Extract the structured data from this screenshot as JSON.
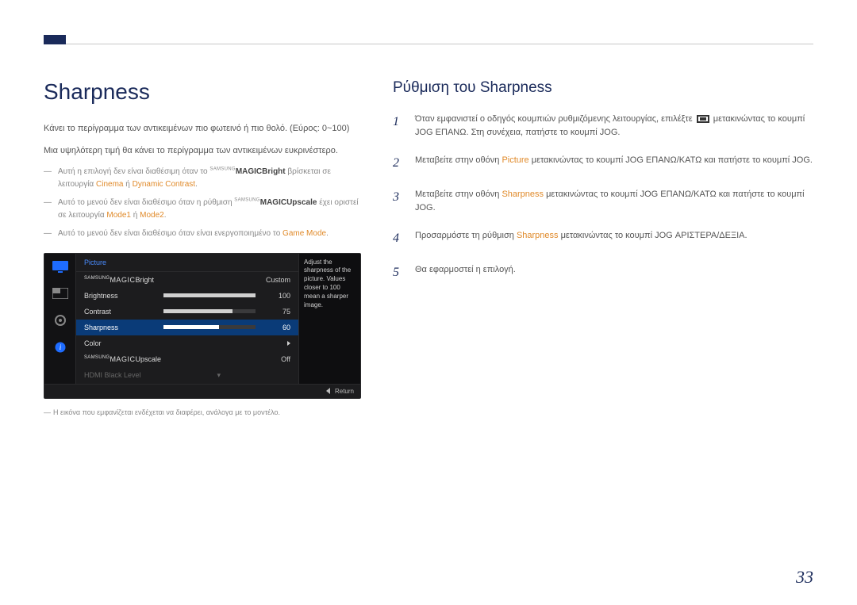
{
  "page_number": "33",
  "left": {
    "title": "Sharpness",
    "p1": "Κάνει το περίγραμμα των αντικειμένων πιο φωτεινό ή πιο θολό. (Εύρος: 0~100)",
    "p2": "Μια υψηλότερη τιμή θα κάνει το περίγραμμα των αντικειμένων ευκρινέστερο.",
    "notes": {
      "n1_pre": "Αυτή η επιλογή δεν είναι διαθέσιμη όταν το ",
      "n1_brand_tiny": "SAMSUNG",
      "n1_brand_bold": "MAGIC",
      "n1_bright": "Bright",
      "n1_mid": " βρίσκεται σε λειτουργία ",
      "n1_cinema": "Cinema",
      "n1_or": " ή ",
      "n1_dc": "Dynamic Contrast",
      "n1_end": ".",
      "n2_pre": "Αυτό το μενού δεν είναι διαθέσιμο όταν η ρύθμιση ",
      "n2_brand_tiny": "SAMSUNG",
      "n2_brand_bold": "MAGIC",
      "n2_upscale": "Upscale",
      "n2_mid": " έχει οριστεί σε λειτουργία ",
      "n2_m1": "Mode1",
      "n2_or": " ή ",
      "n2_m2": "Mode2",
      "n2_end": ".",
      "n3_pre": "Αυτό το μενού δεν είναι διαθέσιμο όταν είναι ενεργοποιημένο το ",
      "n3_gm": "Game Mode",
      "n3_end": "."
    },
    "osd": {
      "header": "Picture",
      "side_text": "Adjust the sharpness of the picture. Values closer to 100 mean a sharper image.",
      "rows": {
        "bright_label": "Bright",
        "bright_tiny": "SAMSUNG",
        "bright_bold": "MAGIC",
        "bright_val": "Custom",
        "brightness_label": "Brightness",
        "brightness_val": "100",
        "contrast_label": "Contrast",
        "contrast_val": "75",
        "sharpness_label": "Sharpness",
        "sharpness_val": "60",
        "color_label": "Color",
        "upscale_label": "Upscale",
        "upscale_tiny": "SAMSUNG",
        "upscale_bold": "MAGIC",
        "upscale_val": "Off",
        "hdmi_label": "HDMI Black Level"
      },
      "return_label": "Return"
    },
    "img_footnote": "Η εικόνα που εμφανίζεται ενδέχεται να διαφέρει, ανάλογα με το μοντέλο."
  },
  "right": {
    "title": "Ρύθμιση του Sharpness",
    "steps": {
      "s1_pre": "Όταν εμφανιστεί ο οδηγός κουμπιών ρυθμιζόμενης λειτουργίας, επιλέξτε ",
      "s1_post": " μετακινώντας το κουμπί JOG ΕΠΑΝΩ. Στη συνέχεια, πατήστε το κουμπί JOG.",
      "s2_pre": "Μεταβείτε στην οθόνη ",
      "s2_hl": "Picture",
      "s2_post": " μετακινώντας το κουμπί JOG ΕΠΑΝΩ/ΚΑΤΩ και πατήστε το κουμπί JOG.",
      "s3_pre": "Μεταβείτε στην οθόνη ",
      "s3_hl": "Sharpness",
      "s3_post": " μετακινώντας το κουμπί JOG ΕΠΑΝΩ/ΚΑΤΩ και πατήστε το κουμπί JOG.",
      "s4_pre": "Προσαρμόστε τη ρύθμιση ",
      "s4_hl": "Sharpness",
      "s4_post": " μετακινώντας το κουμπί JOG ΑΡΙΣΤΕΡΑ/ΔΕΞΙΑ.",
      "s5": "Θα εφαρμοστεί η επιλογή."
    },
    "nums": {
      "n1": "1",
      "n2": "2",
      "n3": "3",
      "n4": "4",
      "n5": "5"
    }
  }
}
